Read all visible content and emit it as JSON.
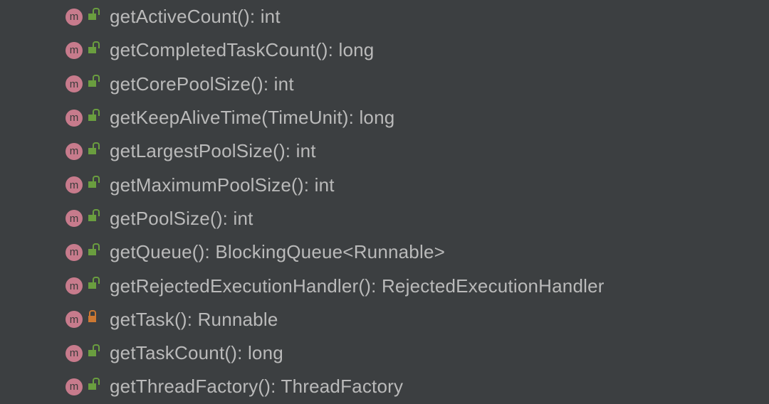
{
  "icon_letter": "m",
  "methods": [
    {
      "signature": "getActiveCount(): int",
      "visibility": "public"
    },
    {
      "signature": "getCompletedTaskCount(): long",
      "visibility": "public"
    },
    {
      "signature": "getCorePoolSize(): int",
      "visibility": "public"
    },
    {
      "signature": "getKeepAliveTime(TimeUnit): long",
      "visibility": "public"
    },
    {
      "signature": "getLargestPoolSize(): int",
      "visibility": "public"
    },
    {
      "signature": "getMaximumPoolSize(): int",
      "visibility": "public"
    },
    {
      "signature": "getPoolSize(): int",
      "visibility": "public"
    },
    {
      "signature": "getQueue(): BlockingQueue<Runnable>",
      "visibility": "public"
    },
    {
      "signature": "getRejectedExecutionHandler(): RejectedExecutionHandler",
      "visibility": "public"
    },
    {
      "signature": "getTask(): Runnable",
      "visibility": "private"
    },
    {
      "signature": "getTaskCount(): long",
      "visibility": "public"
    },
    {
      "signature": "getThreadFactory(): ThreadFactory",
      "visibility": "public"
    }
  ]
}
